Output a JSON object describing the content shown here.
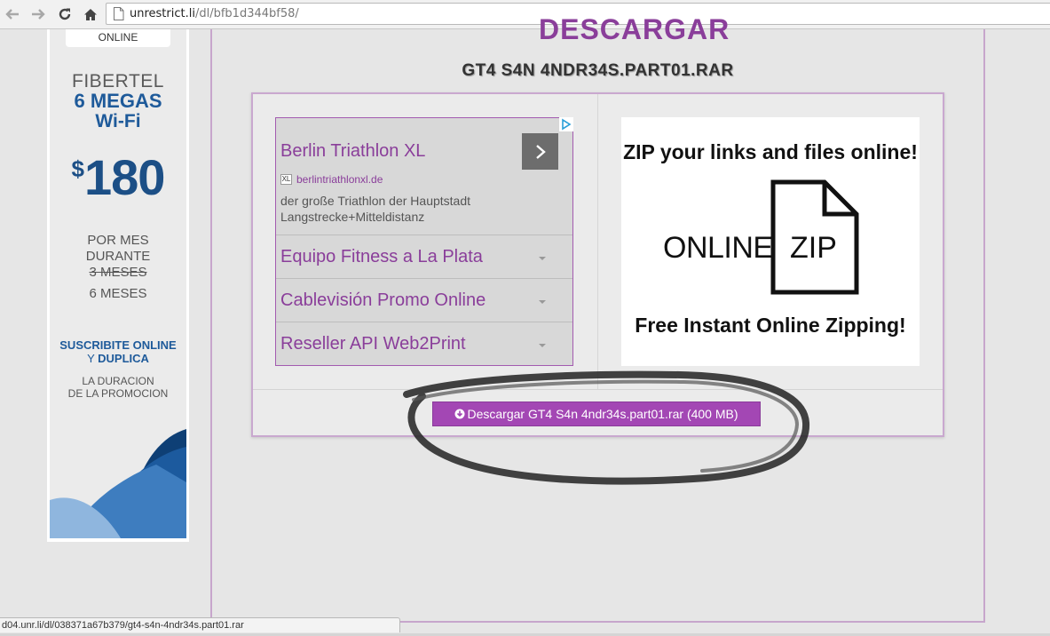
{
  "browser": {
    "url_host": "unrestrict.li",
    "url_path": "/dl/bfb1d344bf58/",
    "status_url": "d04.unr.li/dl/038371a67b379/gt4-s4n-4ndr34s.part01.rar"
  },
  "left_ad": {
    "online": "ONLINE",
    "brand": "FIBERTEL",
    "speed": "6 MEGAS",
    "wifi": "Wi-Fi",
    "currency": "$",
    "price": "180",
    "por_mes": "POR MES",
    "durante": "DURANTE",
    "old_months": "3 MESES",
    "new_months": "6 MESES",
    "suscribite": "SUSCRIBITE ONLINE",
    "y": "Y ",
    "duplica": "DUPLICA",
    "la_duracion": "LA DURACION",
    "de_la_promocion": "DE LA PROMOCION"
  },
  "page": {
    "heading": "DESCARGAR",
    "file_title": "GT4 S4N 4NDR34S.PART01.RAR"
  },
  "text_ad": {
    "title": "Berlin Triathlon XL",
    "xl_badge": "XL",
    "domain": "berlintriathlonxl.de",
    "description": "der große Triathlon der Hauptstadt Langstrecke+Mitteldistanz",
    "rows": [
      "Equipo Fitness a La Plata",
      "Cablevisión Promo Online",
      "Reseller API Web2Print"
    ]
  },
  "zip_banner": {
    "top_text": "ZIP your links and files online!",
    "online_word": "ONLINE",
    "zip_word": "ZIP",
    "bottom_text": "Free Instant Online Zipping!"
  },
  "download": {
    "label": "Descargar GT4 S4n 4ndr34s.part01.rar (400 MB)"
  },
  "colors": {
    "accent_purple": "#a347b4",
    "link_purple": "#8a3e9a",
    "ad_blue": "#1e5a9a"
  }
}
